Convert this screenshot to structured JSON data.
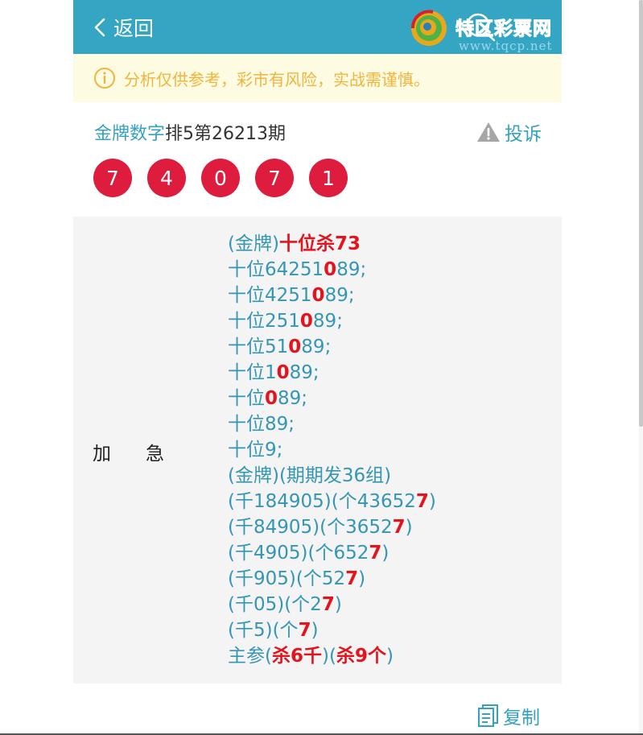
{
  "header": {
    "back_label": "返回"
  },
  "watermark": {
    "title": "特区彩票网",
    "url": "www.tqcp.net"
  },
  "notice": {
    "text": "分析仅供参考，彩市有风险，实战需谨慎。"
  },
  "article": {
    "source": "金牌数字",
    "lottery_issue": "排5第26213期",
    "report_label": "投诉",
    "balls": [
      "7",
      "4",
      "0",
      "7",
      "1"
    ],
    "label_left": "加",
    "label_right": "急",
    "lines": [
      [
        {
          "t": "(金牌)",
          "hl": false
        },
        {
          "t": "十位杀73",
          "hl": true
        }
      ],
      [
        {
          "t": "十位64251",
          "hl": false
        },
        {
          "t": "0",
          "hl": true
        },
        {
          "t": "89;",
          "hl": false
        }
      ],
      [
        {
          "t": "十位4251",
          "hl": false
        },
        {
          "t": "0",
          "hl": true
        },
        {
          "t": "89;",
          "hl": false
        }
      ],
      [
        {
          "t": "十位251",
          "hl": false
        },
        {
          "t": "0",
          "hl": true
        },
        {
          "t": "89;",
          "hl": false
        }
      ],
      [
        {
          "t": "十位51",
          "hl": false
        },
        {
          "t": "0",
          "hl": true
        },
        {
          "t": "89;",
          "hl": false
        }
      ],
      [
        {
          "t": "十位1",
          "hl": false
        },
        {
          "t": "0",
          "hl": true
        },
        {
          "t": "89;",
          "hl": false
        }
      ],
      [
        {
          "t": "十位",
          "hl": false
        },
        {
          "t": "0",
          "hl": true
        },
        {
          "t": "89;",
          "hl": false
        }
      ],
      [
        {
          "t": "十位89;",
          "hl": false
        }
      ],
      [
        {
          "t": "十位9;",
          "hl": false
        }
      ],
      [
        {
          "t": "(金牌)(期期发36组)",
          "hl": false
        }
      ],
      [
        {
          "t": "(千184905)(个43652",
          "hl": false
        },
        {
          "t": "7",
          "hl": true
        },
        {
          "t": ")",
          "hl": false
        }
      ],
      [
        {
          "t": "(千84905)(个3652",
          "hl": false
        },
        {
          "t": "7",
          "hl": true
        },
        {
          "t": ")",
          "hl": false
        }
      ],
      [
        {
          "t": "(千4905)(个652",
          "hl": false
        },
        {
          "t": "7",
          "hl": true
        },
        {
          "t": ")",
          "hl": false
        }
      ],
      [
        {
          "t": "(千905)(个52",
          "hl": false
        },
        {
          "t": "7",
          "hl": true
        },
        {
          "t": ")",
          "hl": false
        }
      ],
      [
        {
          "t": "(千05)(个2",
          "hl": false
        },
        {
          "t": "7",
          "hl": true
        },
        {
          "t": ")",
          "hl": false
        }
      ],
      [
        {
          "t": "(千5)(个",
          "hl": false
        },
        {
          "t": "7",
          "hl": true
        },
        {
          "t": ")",
          "hl": false
        }
      ],
      [
        {
          "t": "主参(",
          "hl": false
        },
        {
          "t": "杀6千",
          "hl": true
        },
        {
          "t": ")(",
          "hl": false
        },
        {
          "t": "杀9个",
          "hl": true
        },
        {
          "t": ")",
          "hl": false
        }
      ]
    ],
    "copy_label": "复制"
  },
  "colors": {
    "header_bg": "#34a5c3",
    "accent": "#35a0c0",
    "ball": "#dd1c3e",
    "highlight": "#e4141f",
    "notice_text": "#f2b43c",
    "notice_bg": "#fefbe3"
  }
}
